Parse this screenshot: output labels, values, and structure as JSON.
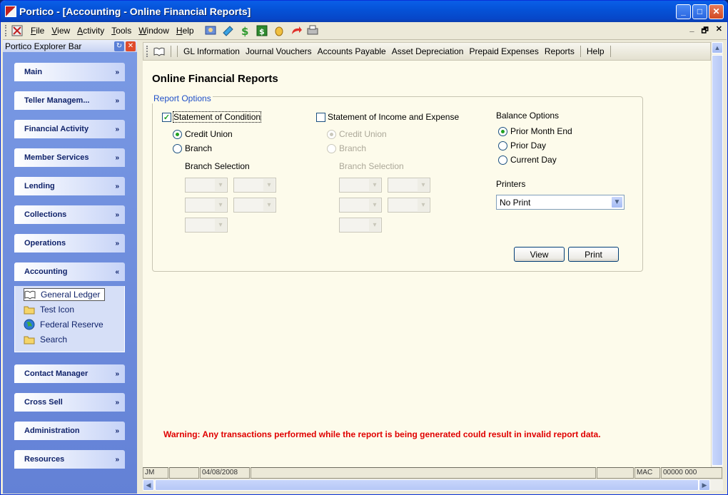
{
  "window": {
    "title": "Portico - [Accounting - Online Financial Reports]",
    "min_glyph": "_",
    "max_glyph": "□",
    "close_glyph": "✕"
  },
  "menu": {
    "items": [
      "File",
      "View",
      "Activity",
      "Tools",
      "Window",
      "Help"
    ],
    "mdi_min": "_",
    "mdi_restore": "🗗",
    "mdi_close": "✕"
  },
  "explorer": {
    "title": "Portico Explorer Bar",
    "groups": [
      {
        "label": "Main",
        "chevron": "»"
      },
      {
        "label": "Teller Managem...",
        "chevron": "»"
      },
      {
        "label": "Financial Activity",
        "chevron": "»"
      },
      {
        "label": "Member Services",
        "chevron": "»"
      },
      {
        "label": "Lending",
        "chevron": "»"
      },
      {
        "label": "Collections",
        "chevron": "»"
      },
      {
        "label": "Operations",
        "chevron": "»"
      },
      {
        "label": "Accounting",
        "chevron": "«"
      },
      {
        "label": "Contact Manager",
        "chevron": "»"
      },
      {
        "label": "Cross Sell",
        "chevron": "»"
      },
      {
        "label": "Administration",
        "chevron": "»"
      },
      {
        "label": "Resources",
        "chevron": "»"
      }
    ],
    "accounting_items": [
      {
        "label": "General Ledger",
        "icon": "book-icon"
      },
      {
        "label": "Test Icon",
        "icon": "folder-icon"
      },
      {
        "label": "Federal Reserve",
        "icon": "globe-icon"
      },
      {
        "label": "Search",
        "icon": "folder-icon"
      }
    ]
  },
  "nav_toolbar": {
    "items": [
      "GL Information",
      "Journal Vouchers",
      "Accounts Payable",
      "Asset Depreciation",
      "Prepaid Expenses",
      "Reports"
    ],
    "help": "Help"
  },
  "page": {
    "title": "Online Financial Reports",
    "report_options_legend": "Report Options",
    "condition": {
      "label": "Statement of Condition",
      "checked": "✓",
      "credit_union": "Credit Union",
      "branch": "Branch",
      "branch_selection": "Branch Selection"
    },
    "income": {
      "label": "Statement of Income and Expense",
      "credit_union": "Credit Union",
      "branch": "Branch",
      "branch_selection": "Branch Selection"
    },
    "balance": {
      "label": "Balance Options",
      "prior_month_end": "Prior Month End",
      "prior_day": "Prior Day",
      "current_day": "Current Day"
    },
    "printers": {
      "label": "Printers",
      "selected": "No Print"
    },
    "view_button": "View",
    "print_button": "Print",
    "warning": "Warning: Any transactions performed while the report is being generated could result in invalid report data."
  },
  "statusbar": {
    "cells": [
      "JM",
      "",
      "04/08/2008",
      "",
      "",
      "MAC",
      "00000 000"
    ]
  }
}
